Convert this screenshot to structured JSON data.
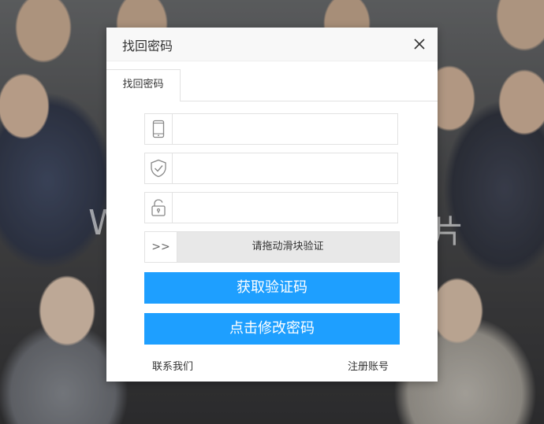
{
  "background": {
    "watermark_left": "W",
    "watermark_right": "片"
  },
  "dialog": {
    "title": "找回密码",
    "close_icon": "close-icon",
    "tab_label": "找回密码",
    "fields": [
      {
        "icon": "phone-icon",
        "value": "",
        "placeholder": ""
      },
      {
        "icon": "shield-check-icon",
        "value": "",
        "placeholder": ""
      },
      {
        "icon": "lock-icon",
        "value": "",
        "placeholder": ""
      }
    ],
    "slider": {
      "handle_icon": ">>",
      "text": "请拖动滑块验证"
    },
    "get_code_button": "获取验证码",
    "change_password_button": "点击修改密码",
    "contact_link": "联系我们",
    "register_link": "注册账号"
  },
  "colors": {
    "primary": "#1e9fff",
    "border": "#e2e2e2",
    "slider_bg": "#e8e8e8"
  }
}
